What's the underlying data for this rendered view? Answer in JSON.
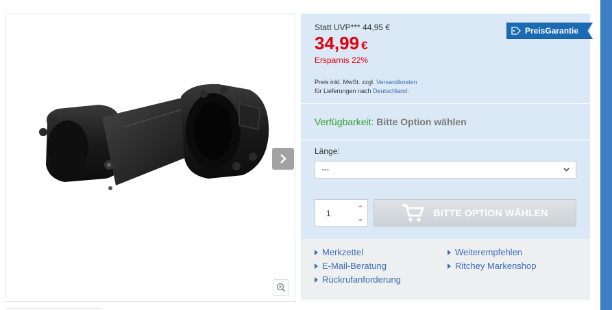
{
  "product": {
    "image_alt": "Ritchey stem",
    "slider_next_icon": "chevron-right-icon",
    "zoom_icon": "zoom-icon"
  },
  "pricing": {
    "uvp_label": "Statt UVP*** 44,95 €",
    "price": "34,99",
    "currency": "€",
    "savings": "Ersparnis 22%",
    "tax_text_1": "Preis inkl. MwSt. zzgl. ",
    "tax_link_shipping": "Versandkosten",
    "tax_text_2": "für Lieferungen nach ",
    "tax_link_country": "Deutschland",
    "tax_text_3": ".",
    "badge": "PreisGarantie"
  },
  "availability": {
    "label": "Verfügbarkeit:",
    "value": "Bitte Option wählen"
  },
  "options": {
    "length_label": "Länge:",
    "length_selected": "---"
  },
  "cart": {
    "quantity": "1",
    "button_label": "BITTE OPTION WÄHLEN"
  },
  "links": [
    {
      "label": "Merkzettel"
    },
    {
      "label": "E-Mail-Beratung"
    },
    {
      "label": "Rückrufanforderung"
    },
    {
      "label": "Weiterempfehlen"
    },
    {
      "label": "Ritchey Markenshop"
    }
  ],
  "colors": {
    "price_red": "#e3000f",
    "availability_green": "#2f9e2f",
    "link_blue": "#3c6eb4",
    "buybox_bg": "#dae9f5",
    "badge_blue": "#1b6ab4"
  }
}
